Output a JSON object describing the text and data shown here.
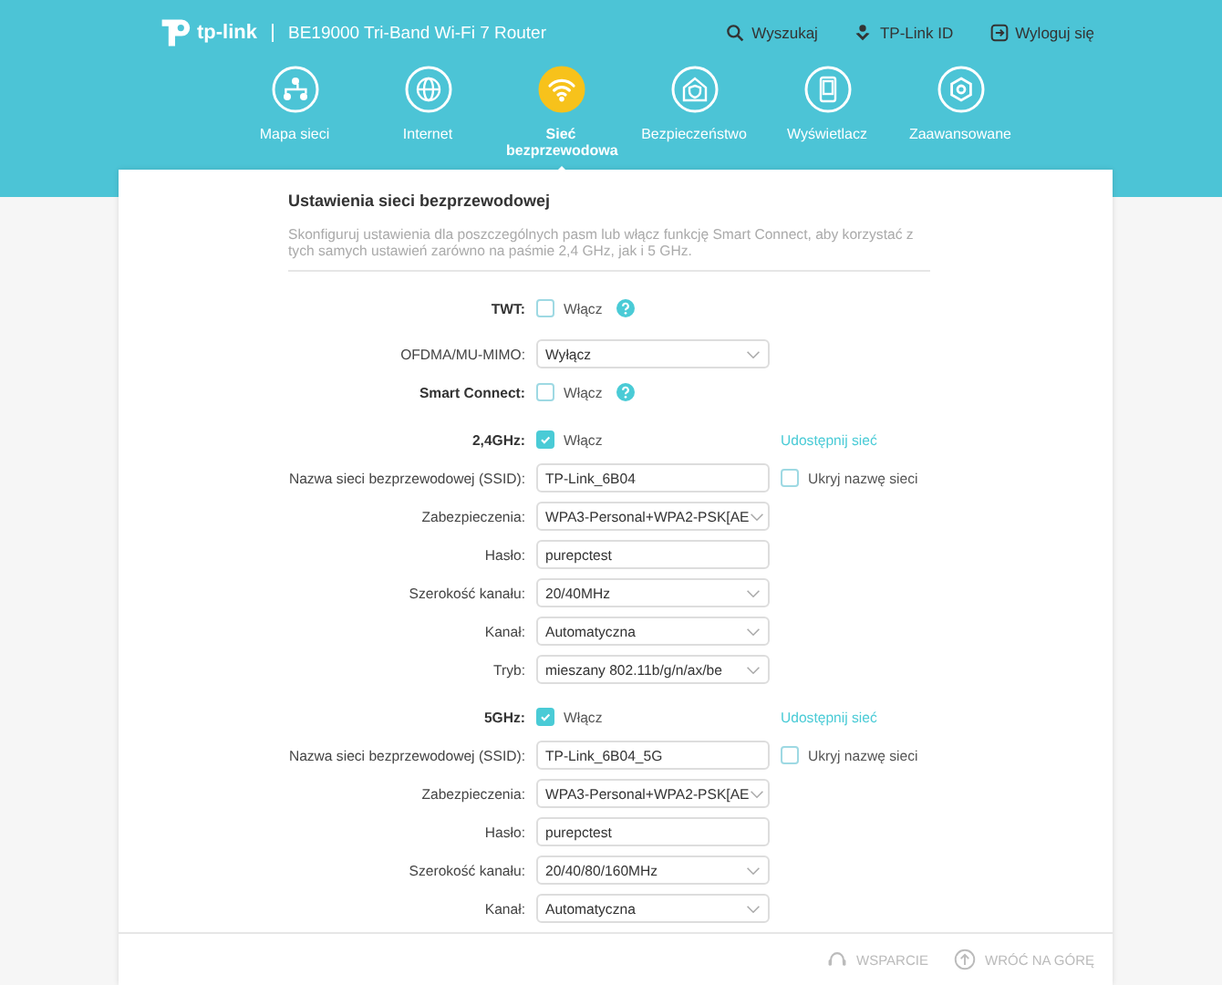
{
  "header": {
    "logo": "tp-link",
    "title": "BE19000 Tri-Band Wi-Fi 7 Router",
    "actions": [
      {
        "kind": "search",
        "label": "Wyszukaj"
      },
      {
        "kind": "id",
        "label": "TP-Link ID"
      },
      {
        "kind": "logout",
        "label": "Wyloguj się"
      }
    ]
  },
  "nav": [
    {
      "kind": "map",
      "label": "Mapa sieci",
      "selected": false
    },
    {
      "kind": "globe",
      "label": "Internet",
      "selected": false
    },
    {
      "kind": "wifi",
      "label": "Sieć bezprzewodowa",
      "selected": true
    },
    {
      "kind": "shield",
      "label": "Bezpieczeństwo",
      "selected": false
    },
    {
      "kind": "display",
      "label": "Wyświetlacz",
      "selected": false
    },
    {
      "kind": "gear",
      "label": "Zaawansowane",
      "selected": false
    }
  ],
  "section": {
    "title": "Ustawienia sieci bezprzewodowej",
    "description": "Skonfiguruj ustawienia dla poszczególnych pasm lub włącz funkcję Smart Connect, aby korzystać z tych samych ustawień zarówno na paśmie 2,4 GHz, jak i 5 GHz."
  },
  "rows": [
    {
      "kind": "checkbox",
      "label": "TWT:",
      "bold": true,
      "option": "Włącz",
      "checked": false,
      "help": true
    },
    {
      "kind": "select",
      "label": "OFDMA/MU-MIMO:",
      "value": "Wyłącz"
    },
    {
      "kind": "checkbox",
      "label": "Smart Connect:",
      "bold": true,
      "option": "Włącz",
      "checked": false,
      "help": true
    },
    {
      "kind": "band",
      "label": "2,4GHz:",
      "bold": true,
      "option": "Włącz",
      "checked": true,
      "link": "Udostępnij sieć"
    },
    {
      "kind": "input",
      "label": "Nazwa sieci bezprzewodowej (SSID):",
      "value": "TP-Link_6B04",
      "side": {
        "label": "Ukryj nazwę sieci",
        "checked": false
      }
    },
    {
      "kind": "select",
      "label": "Zabezpieczenia:",
      "value": "WPA3-Personal+WPA2-PSK[AE"
    },
    {
      "kind": "input",
      "label": "Hasło:",
      "value": "purepctest"
    },
    {
      "kind": "select",
      "label": "Szerokość kanału:",
      "value": "20/40MHz"
    },
    {
      "kind": "select",
      "label": "Kanał:",
      "value": "Automatyczna"
    },
    {
      "kind": "select",
      "label": "Tryb:",
      "value": "mieszany 802.11b/g/n/ax/be"
    },
    {
      "kind": "band",
      "label": "5GHz:",
      "bold": true,
      "option": "Włącz",
      "checked": true,
      "link": "Udostępnij sieć"
    },
    {
      "kind": "input",
      "label": "Nazwa sieci bezprzewodowej (SSID):",
      "value": "TP-Link_6B04_5G",
      "side": {
        "label": "Ukryj nazwę sieci",
        "checked": false
      }
    },
    {
      "kind": "select",
      "label": "Zabezpieczenia:",
      "value": "WPA3-Personal+WPA2-PSK[AE"
    },
    {
      "kind": "input",
      "label": "Hasło:",
      "value": "purepctest"
    },
    {
      "kind": "select",
      "label": "Szerokość kanału:",
      "value": "20/40/80/160MHz"
    },
    {
      "kind": "select",
      "label": "Kanał:",
      "value": "Automatyczna"
    }
  ],
  "footer": [
    {
      "kind": "support",
      "label": "WSPARCIE"
    },
    {
      "kind": "top",
      "label": "WRÓĆ NA GÓRĘ"
    }
  ]
}
